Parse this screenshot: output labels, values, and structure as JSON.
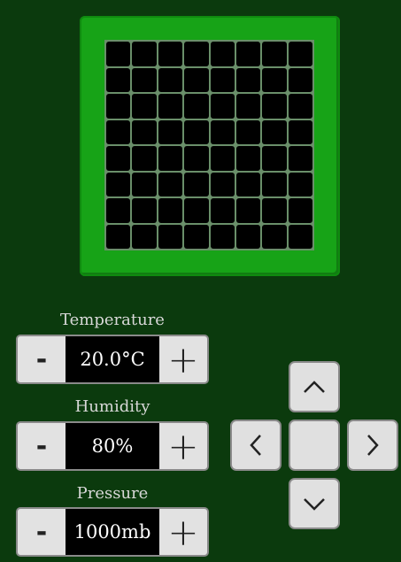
{
  "board": {
    "rows": 8,
    "cols": 8
  },
  "controls": [
    {
      "label": "Temperature",
      "value": "20.0°C",
      "minus": "-",
      "plus": "+"
    },
    {
      "label": "Humidity",
      "value": "80%",
      "minus": "-",
      "plus": "+"
    },
    {
      "label": "Pressure",
      "value": "1000mb",
      "minus": "-",
      "plus": "+"
    }
  ],
  "joystick": {
    "up": "chevron-up-icon",
    "down": "chevron-down-icon",
    "left": "chevron-left-icon",
    "right": "chevron-right-icon",
    "middle": "center"
  },
  "colors": {
    "background": "#0b3a0d",
    "board": "#17a317",
    "led_off": "#000000",
    "button": "#e0e0e0"
  }
}
